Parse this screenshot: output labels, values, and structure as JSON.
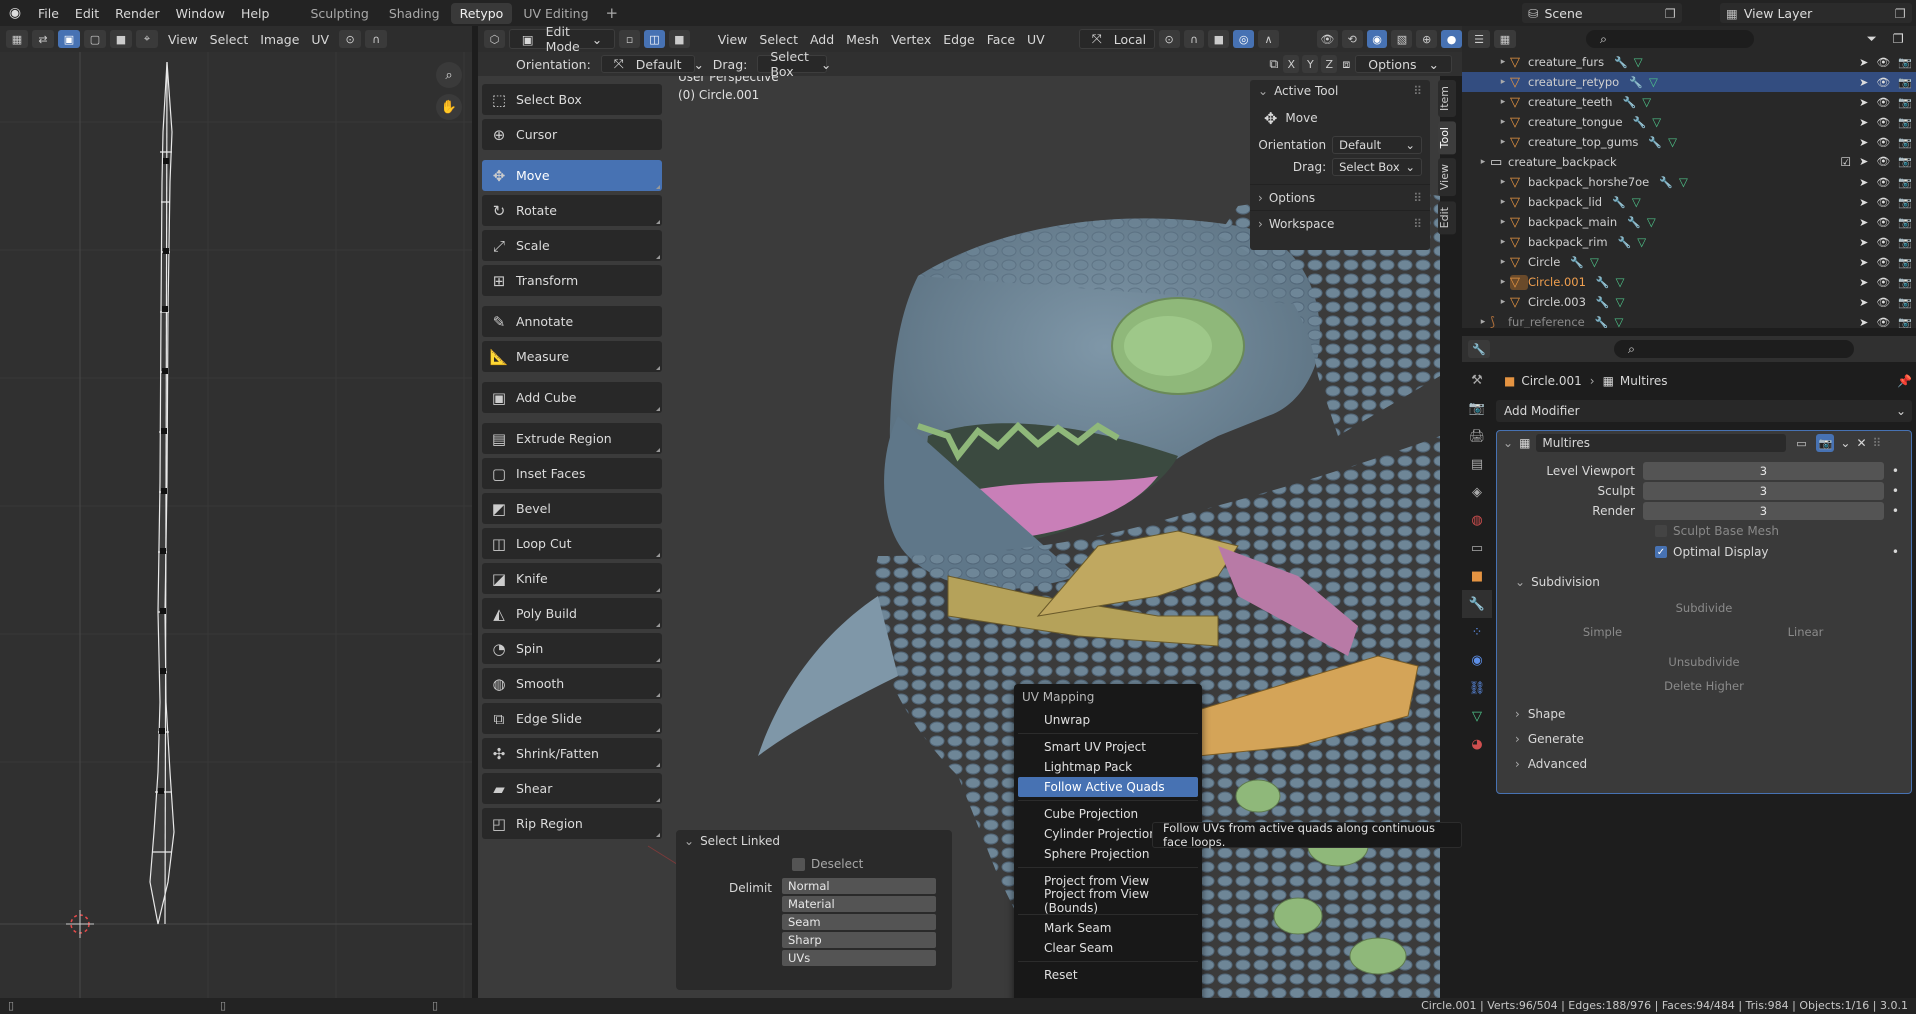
{
  "menus": [
    "File",
    "Edit",
    "Render",
    "Window",
    "Help"
  ],
  "workspaces": [
    "Sculpting",
    "Shading",
    "Retypo",
    "UV Editing"
  ],
  "workspace_add": "+",
  "scene": "Scene",
  "view_layer": "View Layer",
  "uv_header": {
    "items": [
      "View",
      "Select",
      "Image",
      "UV"
    ]
  },
  "view3d_header": {
    "mode": "Edit Mode",
    "menus": [
      "View",
      "Select",
      "Add",
      "Mesh",
      "Vertex",
      "Edge",
      "Face",
      "UV"
    ],
    "transform": "Local"
  },
  "tool_settings": {
    "orientation_label": "Orientation:",
    "orientation_value": "Default",
    "drag_label": "Drag:",
    "drag_value": "Select Box",
    "axes": [
      "X",
      "Y",
      "Z"
    ],
    "options": "Options"
  },
  "viewport": {
    "line1": "User Perspective",
    "line2": "(0) Circle.001"
  },
  "tools": [
    {
      "label": "Select Box",
      "icon": "select-box-icon",
      "glyph": "⬚",
      "active": false
    },
    {
      "label": "Cursor",
      "icon": "cursor-icon",
      "glyph": "⊕",
      "active": false
    },
    {
      "label": "Move",
      "icon": "move-icon",
      "glyph": "✥",
      "active": true
    },
    {
      "label": "Rotate",
      "icon": "rotate-icon",
      "glyph": "↻",
      "active": false
    },
    {
      "label": "Scale",
      "icon": "scale-icon",
      "glyph": "⤢",
      "active": false
    },
    {
      "label": "Transform",
      "icon": "transform-icon",
      "glyph": "⊞",
      "active": false
    },
    {
      "label": "Annotate",
      "icon": "annotate-icon",
      "glyph": "✎",
      "active": false
    },
    {
      "label": "Measure",
      "icon": "measure-icon",
      "glyph": "📐",
      "active": false
    },
    {
      "label": "Add Cube",
      "icon": "add-cube-icon",
      "glyph": "▣",
      "active": false
    },
    {
      "label": "Extrude Region",
      "icon": "extrude-icon",
      "glyph": "▤",
      "active": false
    },
    {
      "label": "Inset Faces",
      "icon": "inset-icon",
      "glyph": "▢",
      "active": false
    },
    {
      "label": "Bevel",
      "icon": "bevel-icon",
      "glyph": "◩",
      "active": false
    },
    {
      "label": "Loop Cut",
      "icon": "loop-cut-icon",
      "glyph": "◫",
      "active": false
    },
    {
      "label": "Knife",
      "icon": "knife-icon",
      "glyph": "◪",
      "active": false
    },
    {
      "label": "Poly Build",
      "icon": "poly-build-icon",
      "glyph": "◭",
      "active": false
    },
    {
      "label": "Spin",
      "icon": "spin-icon",
      "glyph": "◔",
      "active": false
    },
    {
      "label": "Smooth",
      "icon": "smooth-icon",
      "glyph": "◍",
      "active": false
    },
    {
      "label": "Edge Slide",
      "icon": "edge-slide-icon",
      "glyph": "⧉",
      "active": false
    },
    {
      "label": "Shrink/Fatten",
      "icon": "shrink-fatten-icon",
      "glyph": "✣",
      "active": false
    },
    {
      "label": "Shear",
      "icon": "shear-icon",
      "glyph": "▰",
      "active": false
    },
    {
      "label": "Rip Region",
      "icon": "rip-region-icon",
      "glyph": "◰",
      "active": false
    }
  ],
  "active_tool_panel": {
    "title": "Active Tool",
    "tool": "Move",
    "orientation_label": "Orientation",
    "orientation_value": "Default",
    "drag_label": "Drag:",
    "drag_value": "Select Box",
    "options": "Options",
    "workspace": "Workspace"
  },
  "side_tabs": [
    "Item",
    "Tool",
    "View",
    "Edit"
  ],
  "select_linked": {
    "title": "Select Linked",
    "deselect": "Deselect",
    "delimit_label": "Delimit",
    "delimit_options": [
      "Normal",
      "Material",
      "Seam",
      "Sharp",
      "UVs"
    ]
  },
  "uv_menu": {
    "title": "UV Mapping",
    "groups": [
      [
        "Unwrap"
      ],
      [
        "Smart UV Project",
        "Lightmap Pack",
        "Follow Active Quads"
      ],
      [
        "Cube Projection",
        "Cylinder Projection",
        "Sphere Projection"
      ],
      [
        "Project from View",
        "Project from View (Bounds)"
      ],
      [
        "Mark Seam",
        "Clear Seam"
      ],
      [
        "Reset"
      ]
    ],
    "highlighted": "Follow Active Quads",
    "tooltip": "Follow UVs from active quads along continuous face loops."
  },
  "outliner": [
    {
      "name": "creature_furs",
      "indent": 2,
      "type": "mesh",
      "sel": false
    },
    {
      "name": "creature_retypo",
      "indent": 2,
      "type": "mesh",
      "sel": true
    },
    {
      "name": "creature_teeth",
      "indent": 2,
      "type": "mesh",
      "sel": false
    },
    {
      "name": "creature_tongue",
      "indent": 2,
      "type": "mesh",
      "sel": false
    },
    {
      "name": "creature_top_gums",
      "indent": 2,
      "type": "mesh",
      "sel": false
    },
    {
      "name": "creature_backpack",
      "indent": 1,
      "type": "collection",
      "sel": false
    },
    {
      "name": "backpack_horshe7oe",
      "indent": 2,
      "type": "mesh",
      "sel": false
    },
    {
      "name": "backpack_lid",
      "indent": 2,
      "type": "mesh",
      "sel": false
    },
    {
      "name": "backpack_main",
      "indent": 2,
      "type": "mesh",
      "sel": false
    },
    {
      "name": "backpack_rim",
      "indent": 2,
      "type": "mesh",
      "sel": false
    },
    {
      "name": "Circle",
      "indent": 2,
      "type": "mesh",
      "sel": false
    },
    {
      "name": "Circle.001",
      "indent": 2,
      "type": "mesh",
      "sel": false,
      "active": true
    },
    {
      "name": "Circle.003",
      "indent": 2,
      "type": "mesh",
      "sel": false
    },
    {
      "name": "fur_reference",
      "indent": 1,
      "type": "object-dim",
      "sel": false
    }
  ],
  "properties": {
    "breadcrumb_object": "Circle.001",
    "breadcrumb_modifier": "Multires",
    "add_modifier": "Add Modifier",
    "modifier_name": "Multires",
    "level_viewport_label": "Level Viewport",
    "level_viewport": "3",
    "sculpt_label": "Sculpt",
    "sculpt": "3",
    "render_label": "Render",
    "render": "3",
    "sculpt_base_mesh": "Sculpt Base Mesh",
    "optimal_display": "Optimal Display",
    "subdivision": "Subdivision",
    "subdivide": "Subdivide",
    "simple": "Simple",
    "linear": "Linear",
    "unsubdivide": "Unsubdivide",
    "delete_higher": "Delete Higher",
    "shape": "Shape",
    "generate": "Generate",
    "advanced": "Advanced"
  },
  "status": "Circle.001 | Verts:96/504 | Edges:188/976 | Faces:94/484 | Tris:984 | Objects:1/16 | 3.0.1",
  "colors": {
    "accent": "#4772b3",
    "mesh_orange": "#e59442",
    "vertex_group_green": "#4fc48a",
    "creature_blue": "#6d8799",
    "gum_green": "#8fb87a"
  }
}
